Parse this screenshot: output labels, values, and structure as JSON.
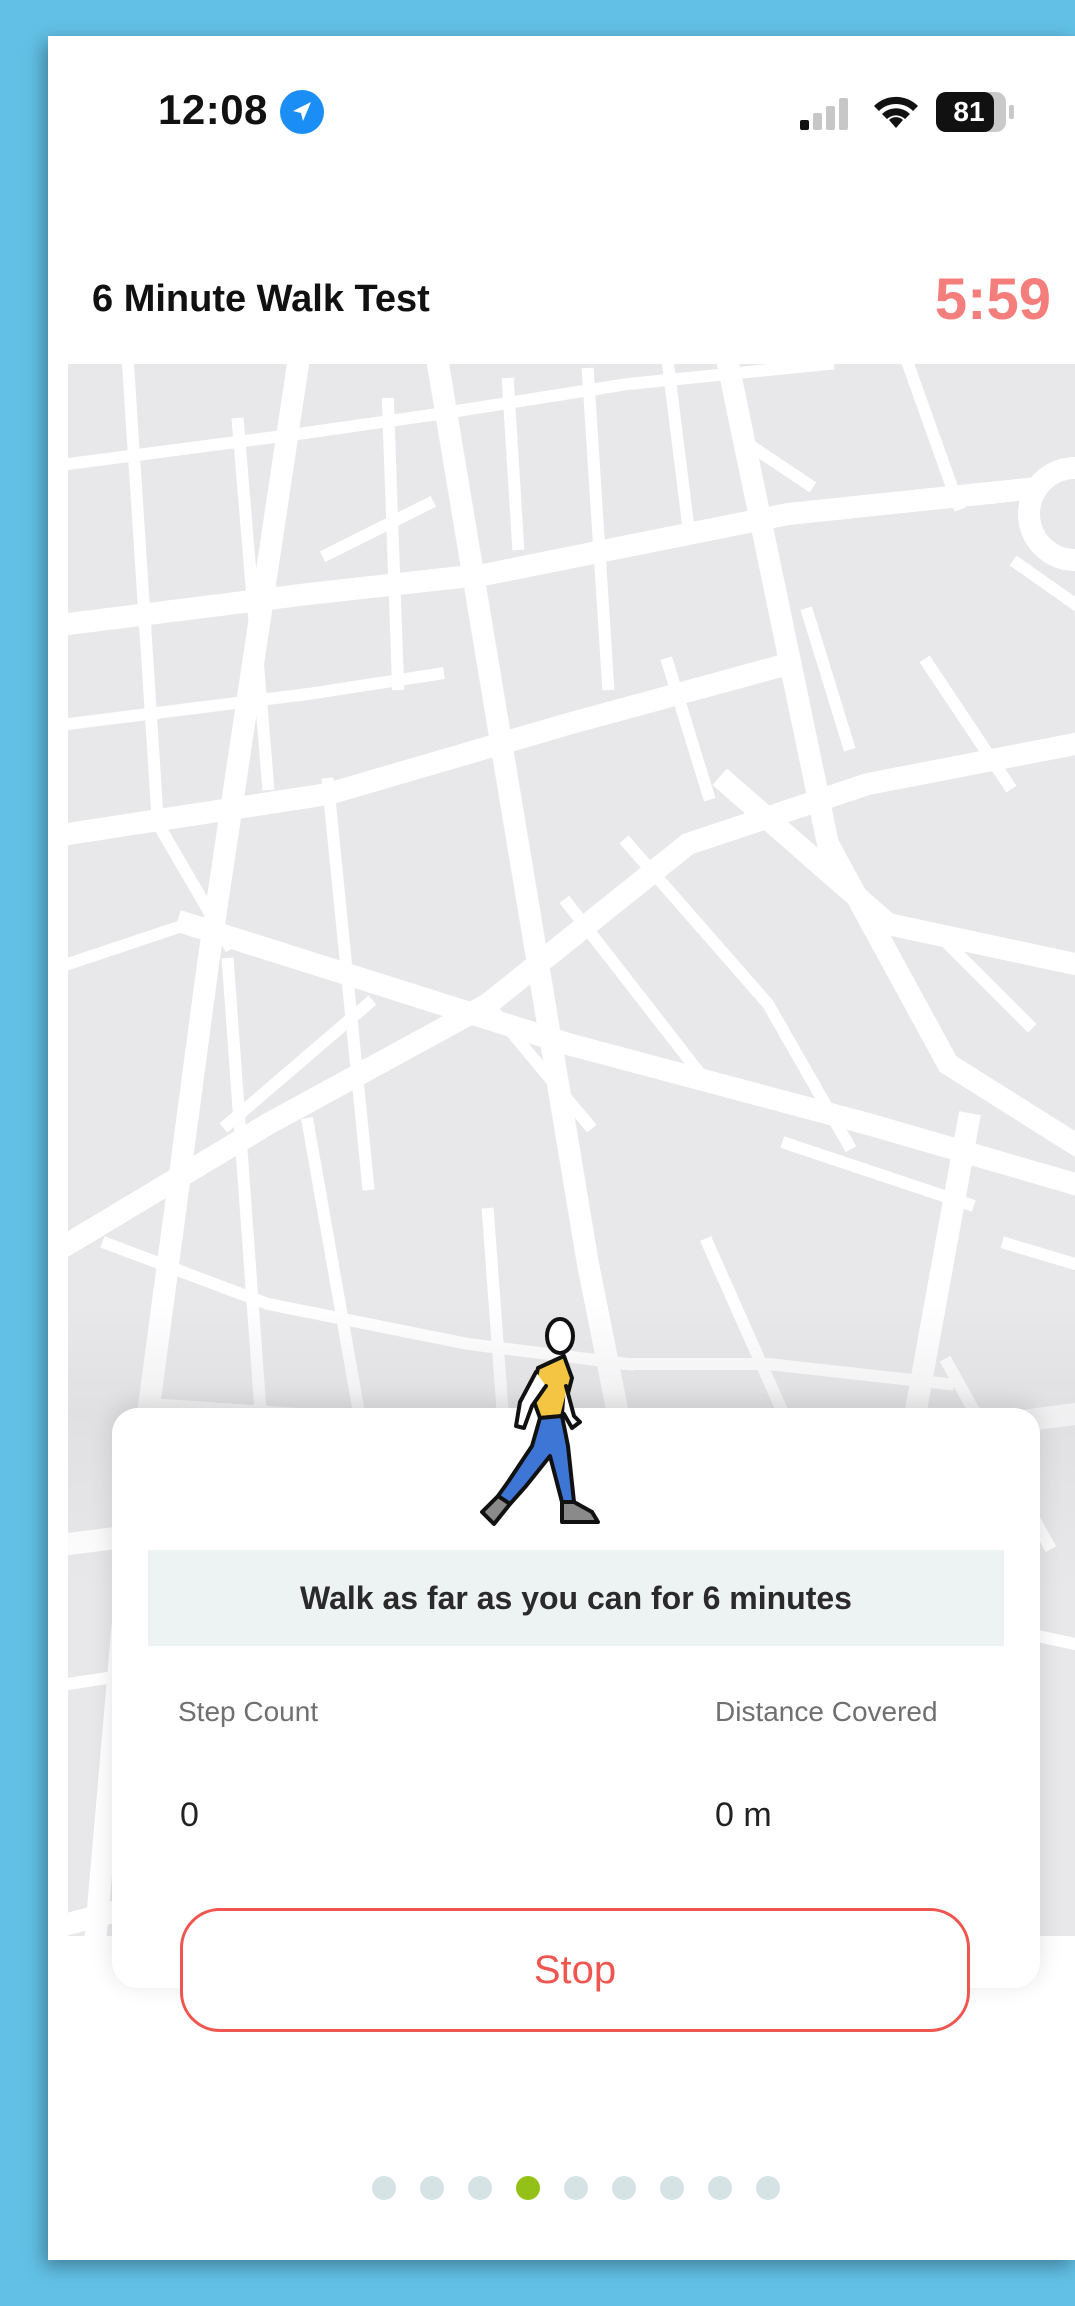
{
  "status_bar": {
    "time": "12:08",
    "battery": "81"
  },
  "header": {
    "title": "6 Minute Walk Test",
    "timer": "5:59"
  },
  "card": {
    "instruction": "Walk as far as you can for 6 minutes",
    "step_count_label": "Step Count",
    "step_count_value": "0",
    "distance_label": "Distance Covered",
    "distance_value": "0 m",
    "stop_label": "Stop"
  },
  "pager": {
    "total": 9,
    "active_index": 3
  },
  "colors": {
    "accent_red": "#f05650",
    "timer_red": "#f37e7b",
    "pager_active": "#94c117",
    "pager_inactive": "#d5e3e5",
    "location_blue": "#1a8ef5"
  },
  "icons": {
    "location": "location-arrow-icon",
    "signal": "cellular-signal-icon",
    "wifi": "wifi-icon",
    "battery": "battery-icon",
    "walker": "walking-person-icon"
  }
}
